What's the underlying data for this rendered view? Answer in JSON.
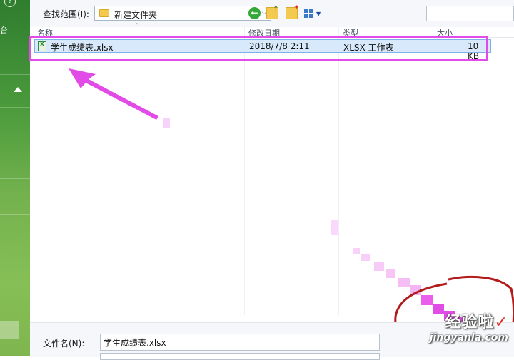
{
  "dialog": {
    "look_in_label": "查找范围(I):",
    "look_in_value": "新建文件夹",
    "file_name_label": "文件名(N):",
    "file_name_value": "学生成绩表.xlsx"
  },
  "columns": {
    "name": "名称",
    "date": "修改日期",
    "type": "类型",
    "size": "大小"
  },
  "files": [
    {
      "name": "学生成绩表.xlsx",
      "date": "2018/7/8 2:11",
      "type": "XLSX 工作表",
      "size": "10 KB"
    }
  ],
  "left_panel": {
    "text": "台",
    "help_icon": "?"
  },
  "icons": {
    "back": "back-arrow-icon",
    "up_folder": "folder-up-icon",
    "new_folder": "new-folder-icon",
    "view_menu": "view-menu-icon",
    "file_type": "excel-file-icon",
    "dropdown": "chevron-down-icon"
  },
  "watermark": {
    "title": "经验啦",
    "url": "jingyanla.com"
  },
  "colors": {
    "annotation": "#e14ce6",
    "circle": "#b31b1b",
    "selection": "#d7e9fb",
    "ribbon": "#5fa843"
  }
}
